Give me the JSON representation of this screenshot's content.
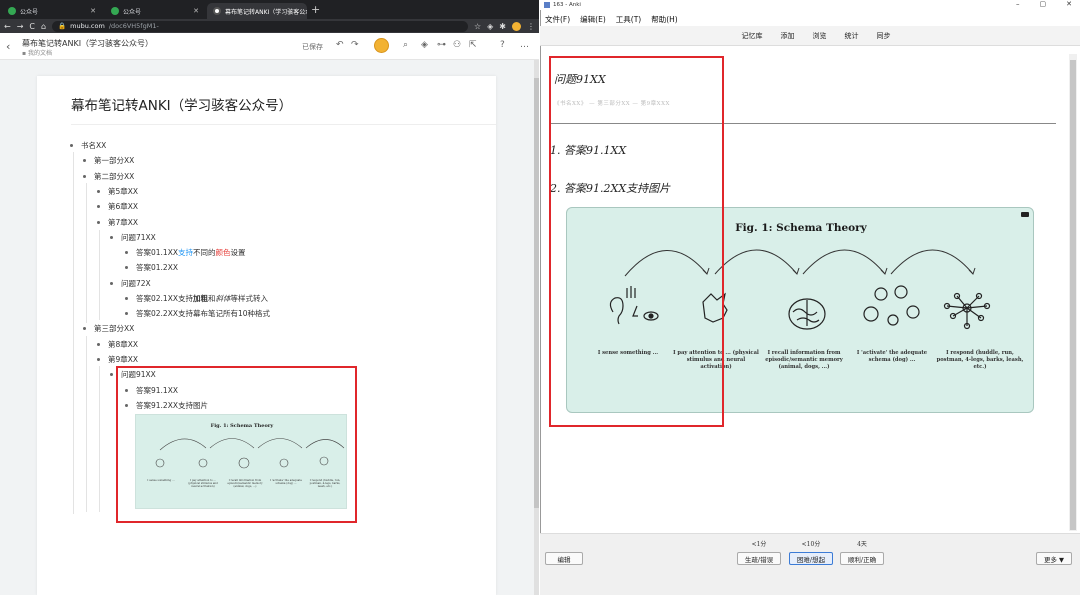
{
  "browser": {
    "tabs": [
      {
        "label": "公众号",
        "active": false,
        "favicon": "#34a853"
      },
      {
        "label": "公众号",
        "active": false,
        "favicon": "#34a853"
      },
      {
        "label": "幕布笔记转ANKI（学习骇客公众号...",
        "active": true,
        "favicon": "#ffffff"
      }
    ],
    "new_tab": "+",
    "url_host": "mubu.com",
    "url_path": "/doc6VH5fgM1-",
    "nav_back": "←",
    "nav_forward": "→",
    "reload": "C",
    "home": "⌂"
  },
  "mubu": {
    "doc_title": "幕布笔记转ANKI（学习骇客公众号）",
    "doc_path": "我的文档",
    "saved": "已保存",
    "page_title": "幕布笔记转ANKI（学习骇客公众号）",
    "outline": {
      "book": "书名XX",
      "part1": "第一部分XX",
      "part2": "第二部分XX",
      "ch5": "第5章XX",
      "ch6": "第6章XX",
      "ch7": "第7章XX",
      "q71": "问题71XX",
      "a011_pre": "答案01.1XX",
      "a011_blue": "支持",
      "a011_mid": "不同的",
      "a011_red": "颜色",
      "a011_post": "设置",
      "a012": "答案01.2XX",
      "q72": "问题72X",
      "a021_pre": "答案02.1XX支持",
      "a021_bold": "加粗",
      "a021_mid": "和",
      "a021_ital": "斜体",
      "a021_post": "等样式转入",
      "a022": "答案02.2XX支持幕布笔记所有10种格式",
      "part3": "第三部分XX",
      "ch8": "第8章XX",
      "ch9": "第9章XX",
      "q91": "问题91XX",
      "a911": "答案91.1XX",
      "a912": "答案91.2XX支持图片"
    },
    "thumb_title": "Fig. 1: Schema Theory"
  },
  "anki": {
    "window_title": "163 - Anki",
    "menu": [
      "文件(F)",
      "编辑(E)",
      "工具(T)",
      "帮助(H)"
    ],
    "toolbar": [
      "记忆库",
      "添加",
      "浏览",
      "统计",
      "同步"
    ],
    "question": "问题91XX",
    "breadcrumb": "《书名XX》 — 第三部分XX — 第9章XXX",
    "answer1": "1. 答案91.1XX",
    "answer2": "2. 答案91.2XX支持图片",
    "edit_button": "编辑",
    "more_button": "更多 ▼",
    "answer_buttons": [
      {
        "due": "<1分",
        "label": "生疏/错误",
        "highlighted": false
      },
      {
        "due": "<10分",
        "label": "困难/想起",
        "highlighted": true
      },
      {
        "due": "4天",
        "label": "顺利/正确",
        "highlighted": false
      }
    ]
  },
  "figure": {
    "title": "Fig. 1: Schema Theory",
    "captions": [
      "I sense something ...",
      "I pay attention to ... (physical stimulus and neural activation)",
      "I recall information from episodic/semantic memory (animal, dogs, ...)",
      "I 'activate' the adequate schema (dog) ...",
      "I respond (huddle, run, postman, 4-legs, barks, leash, etc.)"
    ]
  },
  "colors": {
    "highlight_red": "#e0262b",
    "figure_bg": "#d9efe9",
    "link_blue": "#2196f3",
    "text_red": "#e53935"
  }
}
